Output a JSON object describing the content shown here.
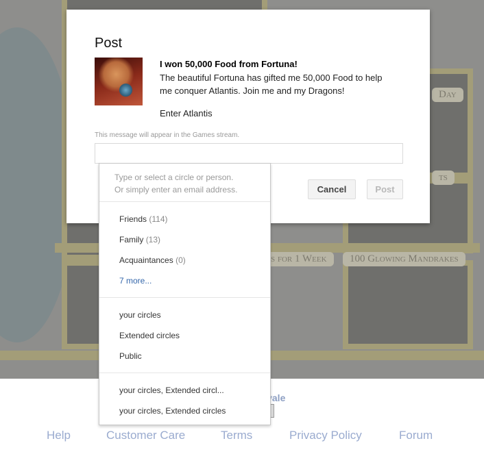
{
  "background": {
    "plates": [
      "Day",
      "ts",
      "s for 1 Week",
      "100 Glowing Mandrakes"
    ],
    "footer_name_fragment": "ngvale"
  },
  "footer": {
    "links": [
      "Help",
      "Customer Care",
      "Terms",
      "Privacy Policy",
      "Forum"
    ]
  },
  "dialog": {
    "title": "Post",
    "post": {
      "title": "I won 50,000 Food from Fortuna!",
      "description": "The beautiful Fortuna has gifted me 50,000 Food to help me conquer Atlantis. Join me and my Dragons!",
      "link": "Enter Atlantis"
    },
    "hint": "This message will appear in the Games stream.",
    "share_input": {
      "value": ""
    },
    "cancel_label": "Cancel",
    "post_label": "Post"
  },
  "dropdown": {
    "placeholder_line1": "Type or select a circle or person.",
    "placeholder_line2": "Or simply enter an email address.",
    "circles": [
      {
        "label": "Friends",
        "count": "(114)"
      },
      {
        "label": "Family",
        "count": "(13)"
      },
      {
        "label": "Acquaintances",
        "count": "(0)"
      }
    ],
    "more": "7 more...",
    "groups": [
      "your circles",
      "Extended circles",
      "Public"
    ],
    "recent": [
      "your circles, Extended circl...",
      "your circles, Extended circles"
    ]
  }
}
